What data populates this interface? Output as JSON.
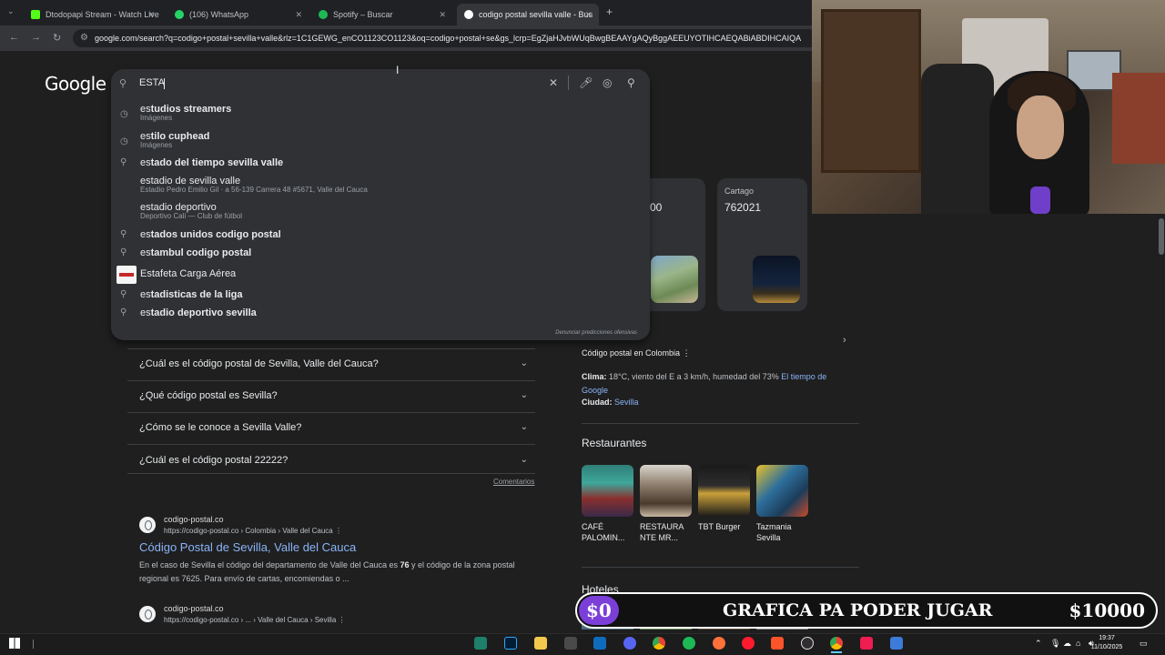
{
  "browser": {
    "tabs": [
      {
        "title": "Dtodopapi Stream - Watch Live",
        "color": "#53fc18"
      },
      {
        "title": "(106) WhatsApp",
        "color": "#25d366"
      },
      {
        "title": "Spotify – Buscar",
        "color": "#1db954"
      },
      {
        "title": "codigo postal sevilla valle - Bus",
        "color": "#ffffff"
      }
    ],
    "new_tab": "+",
    "url": "google.com/search?q=codigo+postal+sevilla+valle&rlz=1C1GEWG_enCO1123CO1123&oq=codigo+postal+se&gs_lcrp=EgZjaHJvbWUqBwgBEAAYgAQyBggAEEUYOTIHCAEQABiABDIHCAIQA"
  },
  "google": {
    "logo": "Google",
    "query": "ESTA",
    "suggestions": [
      {
        "prefix": "es",
        "rest": "tudios streamers",
        "sub": "Imágenes",
        "icon": "history"
      },
      {
        "prefix": "es",
        "rest": "tilo cuphead",
        "sub": "Imágenes",
        "icon": "history"
      },
      {
        "prefix": "es",
        "rest": "tado del tiempo sevilla valle",
        "sub": "",
        "icon": "search"
      },
      {
        "prefix": "",
        "rest": "estadio de sevilla valle",
        "sub": "Estadio Pedro Emilio Gil · a 56-139 Carrera 48 #5671, Valle del Cauca",
        "icon": "none"
      },
      {
        "prefix": "",
        "rest": "estadio deportivo",
        "sub": "Deportivo Cali — Club de fútbol",
        "icon": "none"
      },
      {
        "prefix": "es",
        "rest": "tados unidos codigo postal",
        "sub": "",
        "icon": "search"
      },
      {
        "prefix": "es",
        "rest": "tambul codigo postal",
        "sub": "",
        "icon": "search"
      },
      {
        "prefix": "",
        "rest": "Estafeta Carga Aérea",
        "sub": "",
        "icon": "logo"
      },
      {
        "prefix": "es",
        "rest": "tadisticas de la liga",
        "sub": "",
        "icon": "search"
      },
      {
        "prefix": "es",
        "rest": "tadio deportivo sevilla",
        "sub": "",
        "icon": "search"
      }
    ],
    "report": "Denunciar predicciones ofensivas"
  },
  "cards": {
    "partial_value": "00",
    "cartago_label": "Cartago",
    "cartago_value": "762021"
  },
  "faq": [
    "¿Cuál es el código postal de Sevilla, Valle del Cauca?",
    "¿Qué código postal es Sevilla?",
    "¿Cómo se le conoce a Sevilla Valle?",
    "¿Cuál es el código postal 22222?"
  ],
  "comentarios": "Comentarios",
  "results": [
    {
      "site": "codigo-postal.co",
      "crumb": "https://codigo-postal.co › Colombia › Valle del Cauca",
      "title": "Código Postal de Sevilla, Valle del Cauca",
      "snippet_a": "En el caso de Sevilla el código del departamento de Valle del Cauca es ",
      "snippet_bold": "76",
      "snippet_b": " y el código de la zona postal regional es 7625. Para envío de cartas, encomiendas o ..."
    },
    {
      "site": "codigo-postal.co",
      "crumb": "https://codigo-postal.co › ... › Valle del Cauca › Sevilla"
    }
  ],
  "panel": {
    "subtitle": "Código postal en Colombia",
    "clima_label": "Clima:",
    "clima_text": " 18°C, viento del E a 3 km/h, humedad del 73% ",
    "clima_link": "El tiempo de Google",
    "ciudad_label": "Ciudad:",
    "ciudad_link": "Sevilla",
    "restaurantes_title": "Restaurantes",
    "restaurants": [
      "CAFÉ PALOMIN...",
      "RESTAURA NTE MR...",
      "TBT Burger",
      "Tazmania Sevilla"
    ],
    "hoteles_title": "Hoteles"
  },
  "overlay": {
    "start": "$0",
    "title": "GRAFICA PA PODER JUGAR",
    "goal": "$10000",
    "progress": 0
  },
  "taskbar": {
    "time": "19:37",
    "date": "11/10/2025"
  }
}
